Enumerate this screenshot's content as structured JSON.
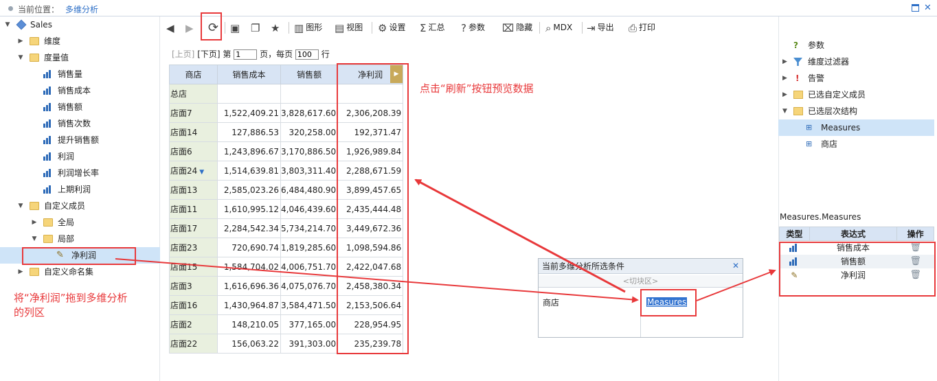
{
  "header": {
    "location_label": "当前位置：",
    "location_value": "多维分析"
  },
  "tree": {
    "root": "Sales",
    "dimension": "维度",
    "measures_folder": "度量值",
    "measures": [
      "销售量",
      "销售成本",
      "销售额",
      "销售次数",
      "提升销售额",
      "利润",
      "利润增长率",
      "上期利润"
    ],
    "custom_members": "自定义成员",
    "global": "全局",
    "local": "局部",
    "net_profit": "净利润",
    "custom_named_set": "自定义命名集"
  },
  "toolbar": {
    "chart": "图形",
    "view": "视图",
    "settings": "设置",
    "summary": "汇总",
    "params": "参数",
    "hide": "隐藏",
    "mdx": "MDX",
    "export": "导出",
    "print": "打印"
  },
  "pager": {
    "prev": "[上页]",
    "next": "[下页]",
    "page_prefix": "第",
    "page_value": "1",
    "page_suffix": "页，每页",
    "size_value": "100",
    "size_suffix": "行"
  },
  "grid": {
    "headers": [
      "商店",
      "销售成本",
      "销售额",
      "净利润"
    ],
    "total_label": "总店",
    "rows": [
      {
        "store": "店面7",
        "cost": "1,522,409.21",
        "sales": "3,828,617.60",
        "profit": "2,306,208.39"
      },
      {
        "store": "店面14",
        "cost": "127,886.53",
        "sales": "320,258.00",
        "profit": "192,371.47"
      },
      {
        "store": "店面6",
        "cost": "1,243,896.67",
        "sales": "3,170,886.50",
        "profit": "1,926,989.84"
      },
      {
        "store": "店面24",
        "cost": "1,514,639.81",
        "sales": "3,803,311.40",
        "profit": "2,288,671.59"
      },
      {
        "store": "店面13",
        "cost": "2,585,023.26",
        "sales": "6,484,480.90",
        "profit": "3,899,457.65"
      },
      {
        "store": "店面11",
        "cost": "1,610,995.12",
        "sales": "4,046,439.60",
        "profit": "2,435,444.48"
      },
      {
        "store": "店面17",
        "cost": "2,284,542.34",
        "sales": "5,734,214.70",
        "profit": "3,449,672.36"
      },
      {
        "store": "店面23",
        "cost": "720,690.74",
        "sales": "1,819,285.60",
        "profit": "1,098,594.86"
      },
      {
        "store": "店面15",
        "cost": "1,584,704.02",
        "sales": "4,006,751.70",
        "profit": "2,422,047.68"
      },
      {
        "store": "店面3",
        "cost": "1,616,696.36",
        "sales": "4,075,076.70",
        "profit": "2,458,380.34"
      },
      {
        "store": "店面16",
        "cost": "1,430,964.87",
        "sales": "3,584,471.50",
        "profit": "2,153,506.64"
      },
      {
        "store": "店面2",
        "cost": "148,210.05",
        "sales": "377,165.00",
        "profit": "228,954.95"
      },
      {
        "store": "店面22",
        "cost": "156,063.22",
        "sales": "391,303.00",
        "profit": "235,239.78"
      }
    ]
  },
  "right_panel": {
    "params": "参数",
    "dim_filter": "维度过滤器",
    "alert": "告警",
    "selected_custom": "已选自定义成员",
    "selected_hierarchy": "已选层次结构",
    "measures_item": "Measures",
    "store_item": "商店",
    "measures_title": "Measures.Measures",
    "table_headers": [
      "类型",
      "表达式",
      "操作"
    ],
    "table_rows": [
      "销售成本",
      "销售额",
      "净利润"
    ]
  },
  "dialog": {
    "title": "当前多维分析所选条件",
    "slice": "<切块区>",
    "row_label": "商店",
    "col_value": "Measures"
  },
  "notes": {
    "refresh": "点击“刷新”按钮预览数据",
    "drag_line1": "将“净利润”拖到多维分析",
    "drag_line2": "的列区"
  },
  "colors": {
    "accent": "#2d6fc7",
    "annotation": "#e8383a",
    "header_bg": "#d8e4f4",
    "rowhead_bg": "#e9f0df"
  }
}
